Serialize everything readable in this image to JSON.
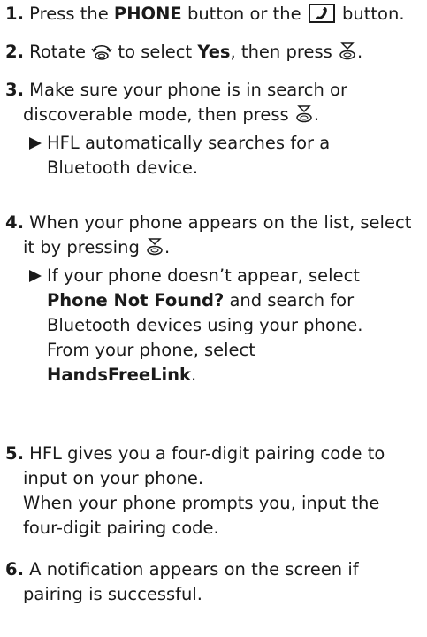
{
  "steps": [
    {
      "num": "1.",
      "t1": " Press the ",
      "b1": "PHONE",
      "t2": " button or the ",
      "t3": " button.",
      "icon": "phone-button-icon"
    },
    {
      "num": "2.",
      "t1": " Rotate ",
      "t2": " to select ",
      "b1": "Yes",
      "t3": ", then press ",
      "t4": ".",
      "icons": [
        "rotate-selector-icon",
        "press-selector-icon"
      ]
    },
    {
      "num": "3.",
      "line1": " Make sure your phone is in search or",
      "line2a": "discoverable mode, then press ",
      "line2b": ".",
      "sub1": "HFL automatically searches for a",
      "sub2": "Bluetooth device.",
      "icon": "press-selector-icon"
    },
    {
      "num": "4.",
      "line1": " When your phone appears on the list, select",
      "line2a": "it by pressing ",
      "line2b": ".",
      "sub1": "If your phone doesn’t appear, select",
      "sub2b": "Phone Not Found?",
      "sub2t": " and search for",
      "sub3": "Bluetooth devices using your phone.",
      "sub4": "From your phone, select",
      "sub5b": "HandsFreeLink",
      "sub5t": ".",
      "icon": "press-selector-icon"
    },
    {
      "num": "5.",
      "line1": " HFL gives you a four-digit pairing code to",
      "line2": "input on your phone.",
      "line3": "When your phone prompts you, input the",
      "line4": "four-digit pairing code."
    },
    {
      "num": "6.",
      "line1": " A notification appears on the screen if",
      "line2": "pairing is successful."
    }
  ]
}
